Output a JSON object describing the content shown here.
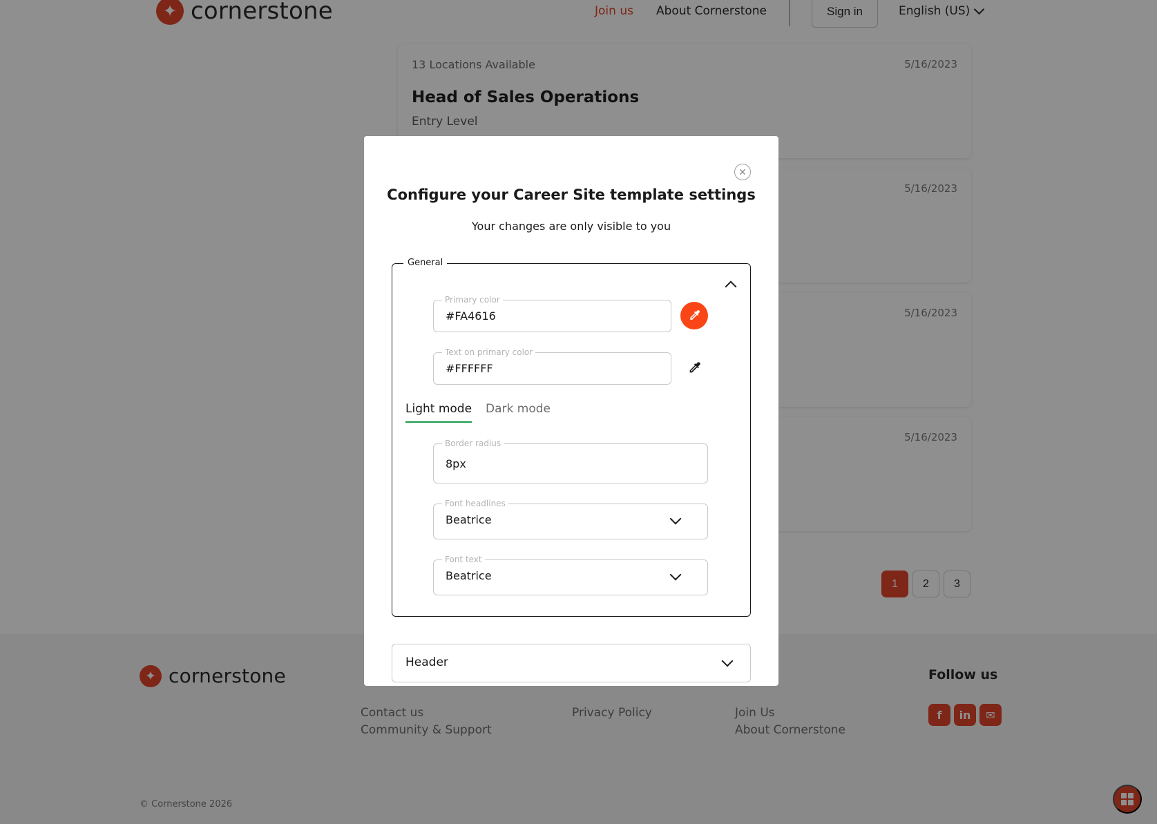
{
  "topbar": {
    "logo_text": "cornerstone",
    "nav_join": "Join us",
    "nav_about": "About Cornerstone",
    "sign_in": "Sign in",
    "language": "English (US)"
  },
  "jobs": [
    {
      "locations": "13 Locations Available",
      "date": "5/16/2023",
      "title": "Head of Sales Operations",
      "level": "Entry Level"
    },
    {
      "locations": "",
      "date": "5/16/2023",
      "title": "",
      "level": ""
    },
    {
      "locations": "",
      "date": "5/16/2023",
      "title": "",
      "level": ""
    },
    {
      "locations": "",
      "date": "5/16/2023",
      "title": "",
      "level": ""
    }
  ],
  "pagination": {
    "pages": [
      "1",
      "2",
      "3"
    ],
    "current": "1"
  },
  "footer": {
    "logo_text": "cornerstone",
    "follow_us": "Follow us",
    "links_col1": [
      "Contact us",
      "Community & Support"
    ],
    "links_col2": [
      "Privacy Policy"
    ],
    "links_col3": [
      "Join Us",
      "About Cornerstone"
    ],
    "social_icons": [
      "facebook-icon",
      "linkedin-icon",
      "mail-icon"
    ],
    "copyright": "© Cornerstone 2026"
  },
  "modal": {
    "title": "Configure your Career Site template settings",
    "subtitle": "Your changes are only visible to you",
    "general_legend": "General",
    "primary_color": {
      "label": "Primary color",
      "value": "#FA4616"
    },
    "text_on_primary": {
      "label": "Text on primary color",
      "value": "#FFFFFF"
    },
    "tabs": {
      "light": "Light mode",
      "dark": "Dark mode",
      "active": "light"
    },
    "border_radius": {
      "label": "Border radius",
      "value": "8px"
    },
    "font_headlines": {
      "label": "Font headlines",
      "value": "Beatrice"
    },
    "font_text": {
      "label": "Font text",
      "value": "Beatrice"
    },
    "header_section": "Header"
  },
  "colors": {
    "brand": "#e0442a",
    "primary_swatch": "#fa4616",
    "tab_underline": "#1a9b4a"
  }
}
